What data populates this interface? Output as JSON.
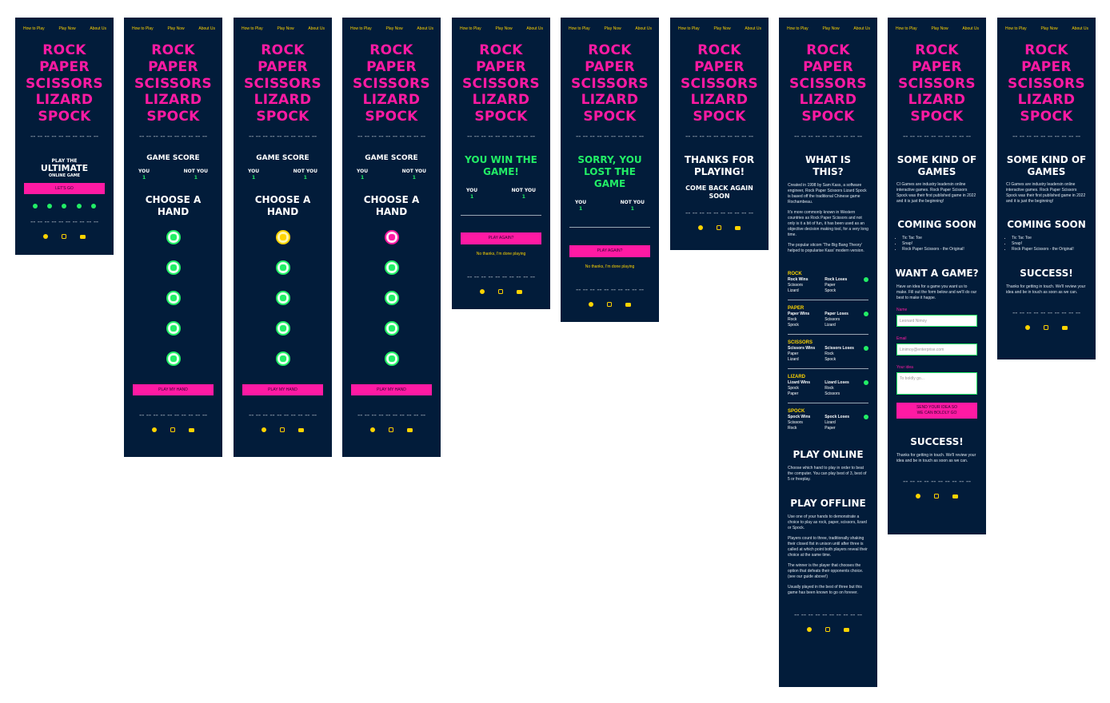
{
  "nav": {
    "how": "How to Play",
    "play": "Play Now",
    "about": "About Us"
  },
  "title": [
    "ROCK",
    "PAPER",
    "SCISSORS",
    "LIZARD",
    "SPOCK"
  ],
  "dashes": "-- -- -- -- -- -- -- -- -- --",
  "home": {
    "play_the": "PLAY THE",
    "ultimate": "ULTIMATE",
    "online_game": "ONLINE GAME",
    "button": "LET'S GO"
  },
  "game": {
    "score_title": "GAME SCORE",
    "you": "YOU",
    "not_you": "NOT YOU",
    "you_score": "1",
    "not_you_score": "1",
    "choose": [
      "CHOOSE A",
      "HAND"
    ],
    "play_button": "PLAY MY HAND"
  },
  "win": {
    "title": [
      "YOU WIN THE",
      "GAME!"
    ],
    "play_again": "PLAY AGAIN?",
    "done": "No thanks, I'm done playing"
  },
  "lose": {
    "title": [
      "SORRY, YOU",
      "LOST THE",
      "GAME"
    ]
  },
  "thanks": {
    "title": [
      "THANKS FOR",
      "PLAYING!"
    ],
    "sub": [
      "COME BACK AGAIN",
      "SOON"
    ]
  },
  "about": {
    "title": [
      "WHAT IS",
      "THIS?"
    ],
    "p1": "Created in 1998 by Sam Kass, a software engineer, Rock Paper Scissors Lizard Spock is based off the traditional Chinese game Rochambeau.",
    "p2": "It's more commonly known in Western countries as Rock Paper Scissors and not only is it a bit of fun, it has been used as an objective decision making tool, for a very long time.",
    "p3": "The popular sitcom 'The Big Bang Theory' helped to popularise Kass' modern version.",
    "rules": [
      {
        "name": "ROCK",
        "wins": "Rock Wins",
        "loses": "Rock Loses",
        "w": [
          "Scissors",
          "Lizard"
        ],
        "l": [
          "Paper",
          "Spock"
        ]
      },
      {
        "name": "PAPER",
        "wins": "Paper Wins",
        "loses": "Paper Loses",
        "w": [
          "Rock",
          "Spock"
        ],
        "l": [
          "Scissors",
          "Lizard"
        ]
      },
      {
        "name": "SCISSORS",
        "wins": "Scissors Wins",
        "loses": "Scissors Loses",
        "w": [
          "Paper",
          "Lizard"
        ],
        "l": [
          "Rock",
          "Spock"
        ]
      },
      {
        "name": "LIZARD",
        "wins": "Lizard Wins",
        "loses": "Lizard Loses",
        "w": [
          "Spock",
          "Paper"
        ],
        "l": [
          "Rock",
          "Scissors"
        ]
      },
      {
        "name": "SPOCK",
        "wins": "Spock Wins",
        "loses": "Spock Loses",
        "w": [
          "Scissors",
          "Rock"
        ],
        "l": [
          "Lizard",
          "Paper"
        ]
      }
    ],
    "online_title": "PLAY ONLINE",
    "online_p": "Choose which hand to play in order to beat the computer. You can play best of 3, best of 5 or freeplay.",
    "offline_title": "PLAY OFFLINE",
    "off_p1": "Use one of your hands to demonstrate a choice to play as rock, paper, scissors, lizard or Spock.",
    "off_p2": "Players count to three, traditionally shaking their closed fist in unison until after three is called at which point both players reveal their choice at the same time.",
    "off_p3": "The winner is the player that chooses the option that defeats their opponents choice. (see our guide above!)",
    "off_p4": "Usually played in the best of three but this game has been known to go on forever."
  },
  "games": {
    "title": [
      "SOME KIND OF",
      "GAMES"
    ],
    "p": "CI Games are industry leadersin online interactive games. Rock Paper Scissors Spock was their first published game in 2022 and it is just the beginning!",
    "coming": "COMING SOON",
    "list": [
      "Tic Tac Toe",
      "Snap!",
      "Rock Paper Scissors - the Original!"
    ],
    "want": "WANT A GAME?",
    "want_p": "Have an idea for a game you want us to make. Fill out the form below and we'll do our best to make it happe.",
    "name_label": "Name",
    "name_ph": "Leonard Nimoy",
    "email_label": "Email",
    "email_ph": "Linimoy@enterprise.com",
    "idea_label": "Your idea",
    "idea_ph": "To boldly go...",
    "send": [
      "SEND YOUR IDEA SO",
      "WE CAN BOLDLY GO"
    ],
    "success": "SUCCESS!",
    "success_p": "Thanks for getting in touch. We'll review your idea and be in touch as soon as we can."
  },
  "colors": {
    "bg": "#021c3a",
    "pink": "#ff1aa3",
    "yellow": "#ffd400",
    "green": "#22ee66"
  }
}
